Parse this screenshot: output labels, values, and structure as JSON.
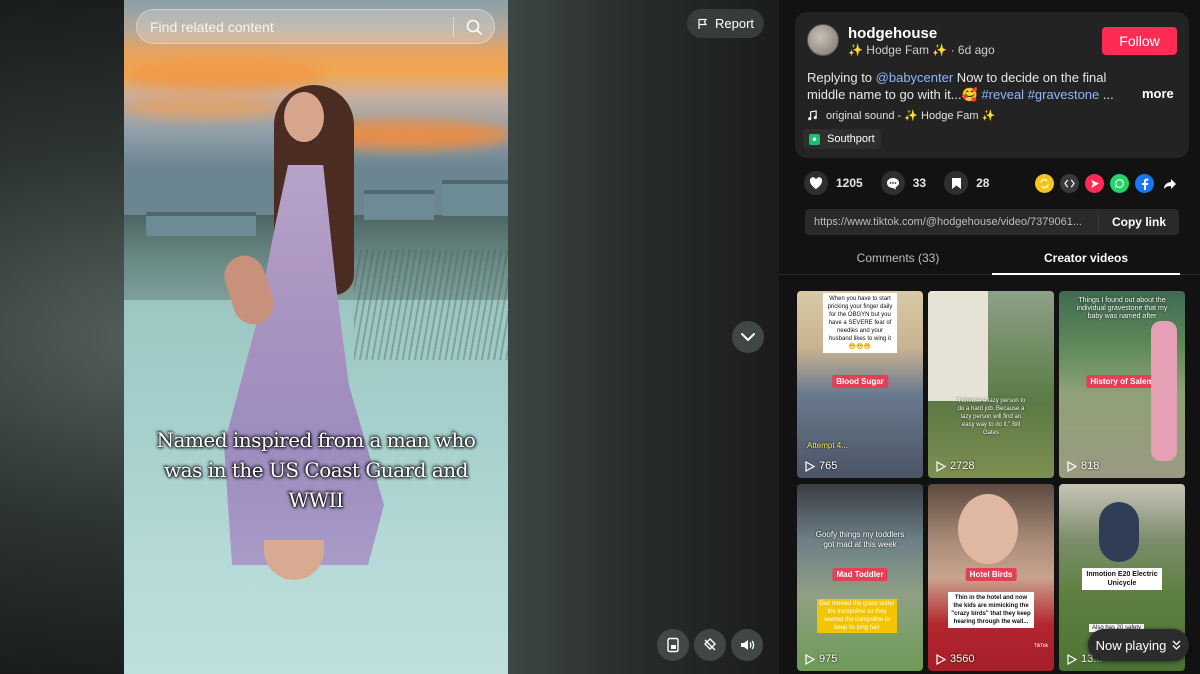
{
  "search": {
    "placeholder": "Find related content"
  },
  "video": {
    "caption": "Named inspired from a man who was in the US Coast Guard and WWII",
    "report_label": "Report"
  },
  "author": {
    "username": "hodgehouse",
    "display_name": "✨ Hodge Fam ✨",
    "separator": " · ",
    "posted": "6d ago",
    "follow_label": "Follow"
  },
  "description": {
    "prefix": "Replying to ",
    "mention": "@babycenter",
    "text": " Now to decide on the final middle name to go with it...🥰 ",
    "tag1": "#reveal",
    "tag2": "#gravestone",
    "ellipsis": " ...",
    "more_label": "more"
  },
  "music": {
    "label": "original sound - ✨ Hodge Fam ✨"
  },
  "location": {
    "label": "Southport"
  },
  "stats": {
    "likes": "1205",
    "comments": "33",
    "saves": "28"
  },
  "share": {
    "url": "https://www.tiktok.com/@hodgehouse/video/7379061...",
    "copy_label": "Copy link",
    "colors": {
      "repost": "#f5c518",
      "embed": "#3a3a3a",
      "send": "#fe2c55",
      "whatsapp": "#25d366",
      "facebook": "#1877f2"
    }
  },
  "tabs": {
    "comments": "Comments (33)",
    "creator": "Creator videos"
  },
  "thumbs": [
    {
      "label": "Blood Sugar",
      "views": "765",
      "note": "When you have to start pricking your finger daily for the OBGYN but you have a SEVERE fear of needles and your husband likes to wing it 😬😬😬",
      "extra": "Attempt 4..."
    },
    {
      "label": "",
      "views": "2728",
      "note": "\"I choose a lazy person to do a hard job. Because a lazy person will find an easy way to do it.\" Bill Gates",
      "extra": ""
    },
    {
      "label": "History of Salem",
      "views": "818",
      "note": "Things I found out about the individual gravestone that my baby was named after",
      "extra": ""
    },
    {
      "label": "Mad Toddler",
      "views": "975",
      "note": "Goofy things my toddlers got mad at this week",
      "extra": "Dad mowed the grass under the trampoline so they wanted the trampoline to keep its long hair"
    },
    {
      "label": "Hotel Birds",
      "views": "3560",
      "note": "Thin in the hotel and now the kids are mimicking the \"crazy birds\" that they keep hearing through the wall...",
      "extra": "TikTok"
    },
    {
      "label": "Inmotion E20 Electric Unicycle",
      "views": "13...",
      "note": "Also has 20 safety",
      "extra": ""
    }
  ],
  "now_playing": {
    "label": "Now playing"
  }
}
